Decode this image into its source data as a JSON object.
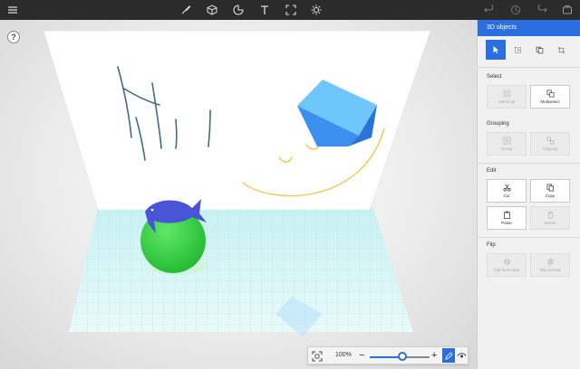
{
  "toolbar": {
    "icons": [
      "hamburger-icon",
      "brush-icon",
      "cube-icon",
      "sticker-icon",
      "text-icon",
      "canvas-icon",
      "effects-icon",
      "undo-icon",
      "history-icon",
      "redo-icon",
      "remix-icon"
    ]
  },
  "canvas": {
    "help_label": "?",
    "drawing_text": "Hi"
  },
  "zoom": {
    "percent_label": "100%",
    "minus_label": "−",
    "plus_label": "+",
    "level": 0.55
  },
  "panel": {
    "title": "3D objects",
    "tabs": [
      "select-icon",
      "rotate-icon",
      "copy-tab-icon",
      "crop-icon"
    ],
    "sections": {
      "select": {
        "title": "Select",
        "buttons": [
          {
            "label": "Select all",
            "enabled": false
          },
          {
            "label": "Multiselect",
            "enabled": true
          }
        ]
      },
      "grouping": {
        "title": "Grouping",
        "buttons": [
          {
            "label": "Group",
            "enabled": false
          },
          {
            "label": "Ungroup",
            "enabled": false
          }
        ]
      },
      "edit": {
        "title": "Edit",
        "buttons": [
          {
            "label": "Cut",
            "enabled": true
          },
          {
            "label": "Copy",
            "enabled": true
          },
          {
            "label": "Paste",
            "enabled": true
          },
          {
            "label": "Delete",
            "enabled": false
          }
        ]
      },
      "flip": {
        "title": "Flip",
        "buttons": [
          {
            "label": "Flip horizontal",
            "enabled": false
          },
          {
            "label": "Flip vertical",
            "enabled": false
          }
        ]
      }
    }
  },
  "colors": {
    "accent": "#2b6ee0",
    "toolbar_bg": "#2b2b2b",
    "ball": "#2ecc40",
    "fish": "#4a55d6",
    "cube": "#4aa8f5"
  }
}
